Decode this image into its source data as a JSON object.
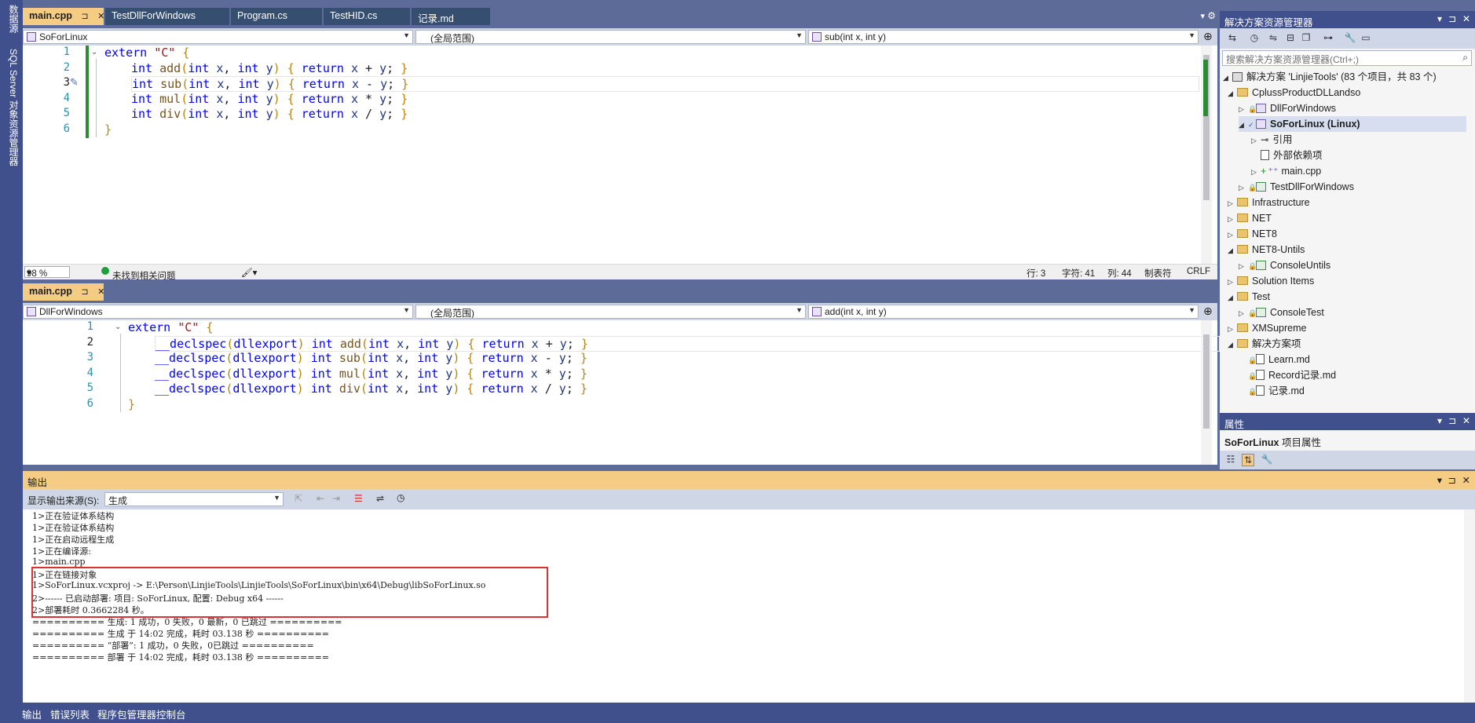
{
  "left_strip": {
    "tab1": "数据源",
    "tab2": "SQL Server 对象资源管理器"
  },
  "editor_tabs": [
    {
      "label": "main.cpp",
      "pin": "⊐",
      "close": "✕"
    },
    {
      "label": "TestDllForWindows"
    },
    {
      "label": "Program.cs"
    },
    {
      "label": "TestHID.cs"
    },
    {
      "label": "记录.md"
    }
  ],
  "editor1": {
    "project_combo": "SoForLinux",
    "scope_combo": "(全局范围)",
    "member_combo": "sub(int x, int y)",
    "lines": [
      {
        "num": "1",
        "text": "extern \"C\" {"
      },
      {
        "num": "2",
        "text": "int add(int x, int y) { return x + y; }"
      },
      {
        "num": "3",
        "text": "int sub(int x, int y) { return x - y; }"
      },
      {
        "num": "4",
        "text": "int mul(int x, int y) { return x * y; }"
      },
      {
        "num": "5",
        "text": "int div(int x, int y) { return x / y; }"
      },
      {
        "num": "6",
        "text": "}"
      }
    ],
    "status": {
      "zoom": "98 %",
      "issues": "未找到相关问题",
      "row": "行: 3",
      "char": "字符: 41",
      "col": "列: 44",
      "tab": "制表符",
      "eol": "CRLF"
    }
  },
  "editor2": {
    "tab_label": "main.cpp",
    "project_combo": "DllForWindows",
    "scope_combo": "(全局范围)",
    "member_combo": "add(int x, int y)",
    "lines": [
      {
        "num": "1",
        "text": "extern \"C\" {"
      },
      {
        "num": "2",
        "text": "__declspec(dllexport) int add(int x, int y) { return x + y; }"
      },
      {
        "num": "3",
        "text": "__declspec(dllexport) int sub(int x, int y) { return x - y; }"
      },
      {
        "num": "4",
        "text": "__declspec(dllexport) int mul(int x, int y) { return x * y; }"
      },
      {
        "num": "5",
        "text": "__declspec(dllexport) int div(int x, int y) { return x / y; }"
      },
      {
        "num": "6",
        "text": "}"
      }
    ]
  },
  "solution_explorer": {
    "title": "解决方案资源管理器",
    "search_placeholder": "搜索解决方案资源管理器(Ctrl+;)",
    "items": [
      {
        "label": "解决方案 'LinjieTools' (83 个项目，共 83 个)",
        "icon": "solution-icon",
        "indent": 0
      },
      {
        "label": "CplussProductDLLandso",
        "icon": "folder-icon",
        "indent": 1
      },
      {
        "label": "DllForWindows",
        "icon": "cpp-project-icon",
        "indent": 2
      },
      {
        "label": "SoForLinux (Linux)",
        "icon": "cpp-project-icon",
        "indent": 2
      },
      {
        "label": "引用",
        "icon": "references-icon",
        "indent": 3
      },
      {
        "label": "外部依赖项",
        "icon": "external-deps-icon",
        "indent": 3
      },
      {
        "label": "main.cpp",
        "icon": "cpp-file-icon",
        "indent": 3
      },
      {
        "label": "TestDllForWindows",
        "icon": "cs-project-icon",
        "indent": 2
      },
      {
        "label": "Infrastructure",
        "icon": "folder-icon",
        "indent": 1
      },
      {
        "label": "NET",
        "icon": "folder-icon",
        "indent": 1
      },
      {
        "label": "NET8",
        "icon": "folder-icon",
        "indent": 1
      },
      {
        "label": "NET8-Untils",
        "icon": "folder-icon",
        "indent": 1
      },
      {
        "label": "ConsoleUntils",
        "icon": "cs-project-icon",
        "indent": 2
      },
      {
        "label": "Solution Items",
        "icon": "folder-icon",
        "indent": 1
      },
      {
        "label": "Test",
        "icon": "folder-icon",
        "indent": 1
      },
      {
        "label": "ConsoleTest",
        "icon": "cs-project-icon",
        "indent": 2
      },
      {
        "label": "XMSupreme",
        "icon": "folder-icon",
        "indent": 1
      },
      {
        "label": "解决方案项",
        "icon": "folder-icon",
        "indent": 1
      },
      {
        "label": "Learn.md",
        "icon": "md-file-icon",
        "indent": 2
      },
      {
        "label": "Record记录.md",
        "icon": "md-file-icon",
        "indent": 2
      },
      {
        "label": "记录.md",
        "icon": "md-file-icon",
        "indent": 2
      }
    ]
  },
  "properties": {
    "title": "属性",
    "subtitle_name": "SoForLinux",
    "subtitle_suffix": "项目属性"
  },
  "output": {
    "title": "输出",
    "source_label": "显示输出来源(S):",
    "source_value": "生成",
    "lines": [
      "1>正在验证体系结构",
      "1>正在验证体系结构",
      "1>正在启动远程生成",
      "1>正在编译源:",
      "1>main.cpp",
      "1>正在链接对象",
      "1>SoForLinux.vcxproj -> E:\\Person\\LinjieTools\\LinjieTools\\SoForLinux\\bin\\x64\\Debug\\libSoForLinux.so",
      "2>------ 已启动部署: 项目: SoForLinux, 配置: Debug x64 ------",
      "2>部署耗时 0.3662284 秒。",
      "========== 生成: 1 成功，0 失败，0 最新，0 已跳过 ==========",
      "========== 生成 于 14:02 完成，耗时 03.138 秒 ==========",
      "========== “部署”: 1 成功，0 失败，0已跳过 ==========",
      "========== 部署 于 14:02 完成，耗时 03.138 秒 =========="
    ]
  },
  "bottom_tabs": [
    "输出",
    "错误列表",
    "程序包管理器控制台"
  ],
  "colors": {
    "accent": "#f5cc84",
    "chrome": "#40508d",
    "highlight_box": "#e03131"
  }
}
